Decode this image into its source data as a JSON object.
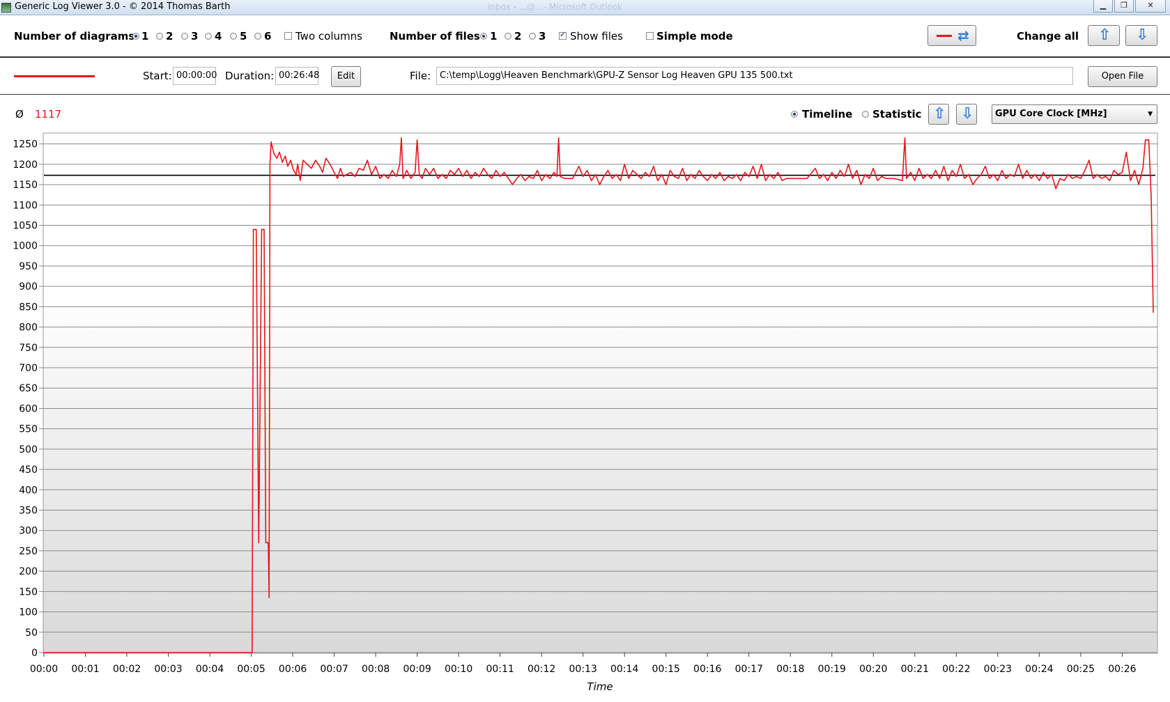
{
  "window": {
    "title": "Generic Log Viewer 3.0 - © 2014 Thomas Barth",
    "background_title": "Inbox - ...@...- Microsoft Outlook"
  },
  "toolbar": {
    "diagrams_label": "Number of diagrams",
    "diagram_options": [
      "1",
      "2",
      "3",
      "4",
      "5",
      "6"
    ],
    "diagram_selected": "1",
    "two_columns_label": "Two columns",
    "two_columns_checked": false,
    "files_label": "Number of files",
    "file_options": [
      "1",
      "2",
      "3"
    ],
    "file_selected": "1",
    "show_files_label": "Show files",
    "show_files_checked": true,
    "simple_mode_label": "Simple mode",
    "simple_mode_checked": false,
    "change_all_label": "Change all"
  },
  "file_row": {
    "start_label": "Start:",
    "start_value": "00:00:00",
    "duration_label": "Duration:",
    "duration_value": "00:26:48",
    "edit_label": "Edit",
    "file_label": "File:",
    "file_path": "C:\\temp\\Logg\\Heaven Benchmark\\GPU-Z Sensor Log Heaven GPU 135 500.txt",
    "open_label": "Open File",
    "series_color": "#e8141b"
  },
  "diagram_header": {
    "avg_symbol": "Ø",
    "avg_value": "1117",
    "timeline_label": "Timeline",
    "statistic_label": "Statistic",
    "mode_selected": "Timeline",
    "sensor_selected": "GPU Core Clock [MHz]"
  },
  "colors": {
    "line": "#e8141b",
    "average": "#000000",
    "arrow": "#2f7fd8"
  },
  "chart_data": {
    "type": "line",
    "xlabel": "Time",
    "ylabel": "",
    "ylim": [
      0,
      1270
    ],
    "yticks": [
      0,
      50,
      100,
      150,
      200,
      250,
      300,
      350,
      400,
      450,
      500,
      550,
      600,
      650,
      700,
      750,
      800,
      850,
      900,
      950,
      1000,
      1050,
      1100,
      1150,
      1200,
      1250
    ],
    "xtick_labels": [
      "00:00",
      "00:01",
      "00:02",
      "00:03",
      "00:04",
      "00:05",
      "00:06",
      "00:07",
      "00:08",
      "00:09",
      "00:10",
      "00:11",
      "00:12",
      "00:13",
      "00:14",
      "00:15",
      "00:16",
      "00:17",
      "00:18",
      "00:19",
      "00:20",
      "00:21",
      "00:22",
      "00:23",
      "00:24",
      "00:25",
      "00:26"
    ],
    "x_unit": "minutes",
    "average_line": 1173,
    "grid": true,
    "series": [
      {
        "color": "#e8141b",
        "points": [
          [
            0,
            0
          ],
          [
            5.02,
            0
          ],
          [
            5.05,
            1040
          ],
          [
            5.12,
            1040
          ],
          [
            5.18,
            270
          ],
          [
            5.25,
            1040
          ],
          [
            5.31,
            1040
          ],
          [
            5.35,
            270
          ],
          [
            5.41,
            270
          ],
          [
            5.43,
            135
          ],
          [
            5.45,
            1200
          ],
          [
            5.48,
            1255
          ],
          [
            5.55,
            1225
          ],
          [
            5.62,
            1215
          ],
          [
            5.68,
            1230
          ],
          [
            5.75,
            1205
          ],
          [
            5.82,
            1220
          ],
          [
            5.88,
            1195
          ],
          [
            5.95,
            1210
          ],
          [
            6.02,
            1185
          ],
          [
            6.08,
            1175
          ],
          [
            6.12,
            1200
          ],
          [
            6.18,
            1160
          ],
          [
            6.25,
            1210
          ],
          [
            6.35,
            1200
          ],
          [
            6.45,
            1190
          ],
          [
            6.55,
            1210
          ],
          [
            6.65,
            1195
          ],
          [
            6.72,
            1180
          ],
          [
            6.8,
            1215
          ],
          [
            6.9,
            1200
          ],
          [
            7.0,
            1180
          ],
          [
            7.08,
            1165
          ],
          [
            7.15,
            1190
          ],
          [
            7.22,
            1170
          ],
          [
            7.3,
            1175
          ],
          [
            7.4,
            1180
          ],
          [
            7.5,
            1170
          ],
          [
            7.6,
            1190
          ],
          [
            7.7,
            1185
          ],
          [
            7.8,
            1210
          ],
          [
            7.9,
            1175
          ],
          [
            8.0,
            1195
          ],
          [
            8.1,
            1165
          ],
          [
            8.2,
            1175
          ],
          [
            8.3,
            1165
          ],
          [
            8.4,
            1185
          ],
          [
            8.5,
            1170
          ],
          [
            8.58,
            1200
          ],
          [
            8.62,
            1265
          ],
          [
            8.66,
            1165
          ],
          [
            8.75,
            1185
          ],
          [
            8.85,
            1165
          ],
          [
            8.95,
            1180
          ],
          [
            9.0,
            1260
          ],
          [
            9.05,
            1175
          ],
          [
            9.12,
            1165
          ],
          [
            9.2,
            1190
          ],
          [
            9.3,
            1175
          ],
          [
            9.4,
            1190
          ],
          [
            9.5,
            1165
          ],
          [
            9.6,
            1175
          ],
          [
            9.7,
            1165
          ],
          [
            9.8,
            1185
          ],
          [
            9.9,
            1175
          ],
          [
            10.0,
            1190
          ],
          [
            10.1,
            1170
          ],
          [
            10.2,
            1185
          ],
          [
            10.3,
            1165
          ],
          [
            10.4,
            1180
          ],
          [
            10.5,
            1170
          ],
          [
            10.6,
            1190
          ],
          [
            10.7,
            1175
          ],
          [
            10.8,
            1165
          ],
          [
            10.9,
            1185
          ],
          [
            11.0,
            1170
          ],
          [
            11.1,
            1180
          ],
          [
            11.2,
            1165
          ],
          [
            11.3,
            1150
          ],
          [
            11.4,
            1165
          ],
          [
            11.5,
            1175
          ],
          [
            11.6,
            1160
          ],
          [
            11.7,
            1170
          ],
          [
            11.8,
            1165
          ],
          [
            11.9,
            1185
          ],
          [
            12.0,
            1160
          ],
          [
            12.1,
            1175
          ],
          [
            12.2,
            1165
          ],
          [
            12.3,
            1180
          ],
          [
            12.37,
            1170
          ],
          [
            12.41,
            1265
          ],
          [
            12.45,
            1170
          ],
          [
            12.55,
            1165
          ],
          [
            12.65,
            1165
          ],
          [
            12.75,
            1165
          ],
          [
            12.8,
            1175
          ],
          [
            12.9,
            1195
          ],
          [
            13.0,
            1170
          ],
          [
            13.1,
            1185
          ],
          [
            13.2,
            1160
          ],
          [
            13.3,
            1175
          ],
          [
            13.4,
            1150
          ],
          [
            13.5,
            1170
          ],
          [
            13.6,
            1185
          ],
          [
            13.7,
            1165
          ],
          [
            13.8,
            1175
          ],
          [
            13.9,
            1160
          ],
          [
            14.0,
            1200
          ],
          [
            14.1,
            1165
          ],
          [
            14.2,
            1185
          ],
          [
            14.3,
            1175
          ],
          [
            14.4,
            1165
          ],
          [
            14.5,
            1180
          ],
          [
            14.6,
            1170
          ],
          [
            14.7,
            1195
          ],
          [
            14.8,
            1160
          ],
          [
            14.9,
            1175
          ],
          [
            15.0,
            1150
          ],
          [
            15.1,
            1185
          ],
          [
            15.2,
            1170
          ],
          [
            15.3,
            1165
          ],
          [
            15.4,
            1190
          ],
          [
            15.5,
            1160
          ],
          [
            15.6,
            1175
          ],
          [
            15.7,
            1165
          ],
          [
            15.8,
            1185
          ],
          [
            15.9,
            1170
          ],
          [
            16.0,
            1160
          ],
          [
            16.1,
            1175
          ],
          [
            16.2,
            1165
          ],
          [
            16.3,
            1180
          ],
          [
            16.4,
            1160
          ],
          [
            16.5,
            1170
          ],
          [
            16.6,
            1165
          ],
          [
            16.7,
            1175
          ],
          [
            16.8,
            1160
          ],
          [
            16.9,
            1180
          ],
          [
            17.0,
            1170
          ],
          [
            17.1,
            1195
          ],
          [
            17.2,
            1165
          ],
          [
            17.3,
            1200
          ],
          [
            17.4,
            1160
          ],
          [
            17.5,
            1175
          ],
          [
            17.6,
            1165
          ],
          [
            17.7,
            1180
          ],
          [
            17.8,
            1160
          ],
          [
            17.9,
            1165
          ],
          [
            18.0,
            1165
          ],
          [
            18.2,
            1165
          ],
          [
            18.4,
            1165
          ],
          [
            18.6,
            1190
          ],
          [
            18.7,
            1165
          ],
          [
            18.8,
            1175
          ],
          [
            18.9,
            1160
          ],
          [
            19.0,
            1180
          ],
          [
            19.1,
            1165
          ],
          [
            19.2,
            1185
          ],
          [
            19.3,
            1170
          ],
          [
            19.4,
            1200
          ],
          [
            19.5,
            1165
          ],
          [
            19.6,
            1185
          ],
          [
            19.7,
            1150
          ],
          [
            19.8,
            1175
          ],
          [
            19.9,
            1165
          ],
          [
            20.0,
            1190
          ],
          [
            20.1,
            1160
          ],
          [
            20.2,
            1170
          ],
          [
            20.3,
            1165
          ],
          [
            20.5,
            1165
          ],
          [
            20.7,
            1160
          ],
          [
            20.76,
            1265
          ],
          [
            20.8,
            1165
          ],
          [
            20.9,
            1180
          ],
          [
            21.0,
            1160
          ],
          [
            21.1,
            1190
          ],
          [
            21.2,
            1165
          ],
          [
            21.3,
            1175
          ],
          [
            21.4,
            1165
          ],
          [
            21.5,
            1185
          ],
          [
            21.6,
            1165
          ],
          [
            21.7,
            1195
          ],
          [
            21.8,
            1160
          ],
          [
            21.9,
            1185
          ],
          [
            22.0,
            1170
          ],
          [
            22.1,
            1200
          ],
          [
            22.2,
            1165
          ],
          [
            22.3,
            1175
          ],
          [
            22.4,
            1150
          ],
          [
            22.5,
            1165
          ],
          [
            22.6,
            1175
          ],
          [
            22.7,
            1195
          ],
          [
            22.8,
            1165
          ],
          [
            22.9,
            1175
          ],
          [
            23.0,
            1160
          ],
          [
            23.1,
            1185
          ],
          [
            23.2,
            1165
          ],
          [
            23.3,
            1175
          ],
          [
            23.4,
            1170
          ],
          [
            23.5,
            1200
          ],
          [
            23.6,
            1165
          ],
          [
            23.7,
            1185
          ],
          [
            23.8,
            1165
          ],
          [
            23.9,
            1175
          ],
          [
            24.0,
            1160
          ],
          [
            24.1,
            1180
          ],
          [
            24.2,
            1165
          ],
          [
            24.3,
            1175
          ],
          [
            24.4,
            1140
          ],
          [
            24.5,
            1165
          ],
          [
            24.6,
            1160
          ],
          [
            24.7,
            1175
          ],
          [
            24.8,
            1165
          ],
          [
            24.9,
            1170
          ],
          [
            25.0,
            1165
          ],
          [
            25.1,
            1185
          ],
          [
            25.2,
            1210
          ],
          [
            25.3,
            1165
          ],
          [
            25.4,
            1175
          ],
          [
            25.5,
            1165
          ],
          [
            25.6,
            1170
          ],
          [
            25.7,
            1160
          ],
          [
            25.8,
            1185
          ],
          [
            25.9,
            1175
          ],
          [
            26.0,
            1180
          ],
          [
            26.1,
            1230
          ],
          [
            26.2,
            1160
          ],
          [
            26.3,
            1185
          ],
          [
            26.4,
            1150
          ],
          [
            26.5,
            1190
          ],
          [
            26.56,
            1260
          ],
          [
            26.64,
            1260
          ],
          [
            26.7,
            1120
          ],
          [
            26.75,
            835
          ]
        ]
      }
    ]
  }
}
